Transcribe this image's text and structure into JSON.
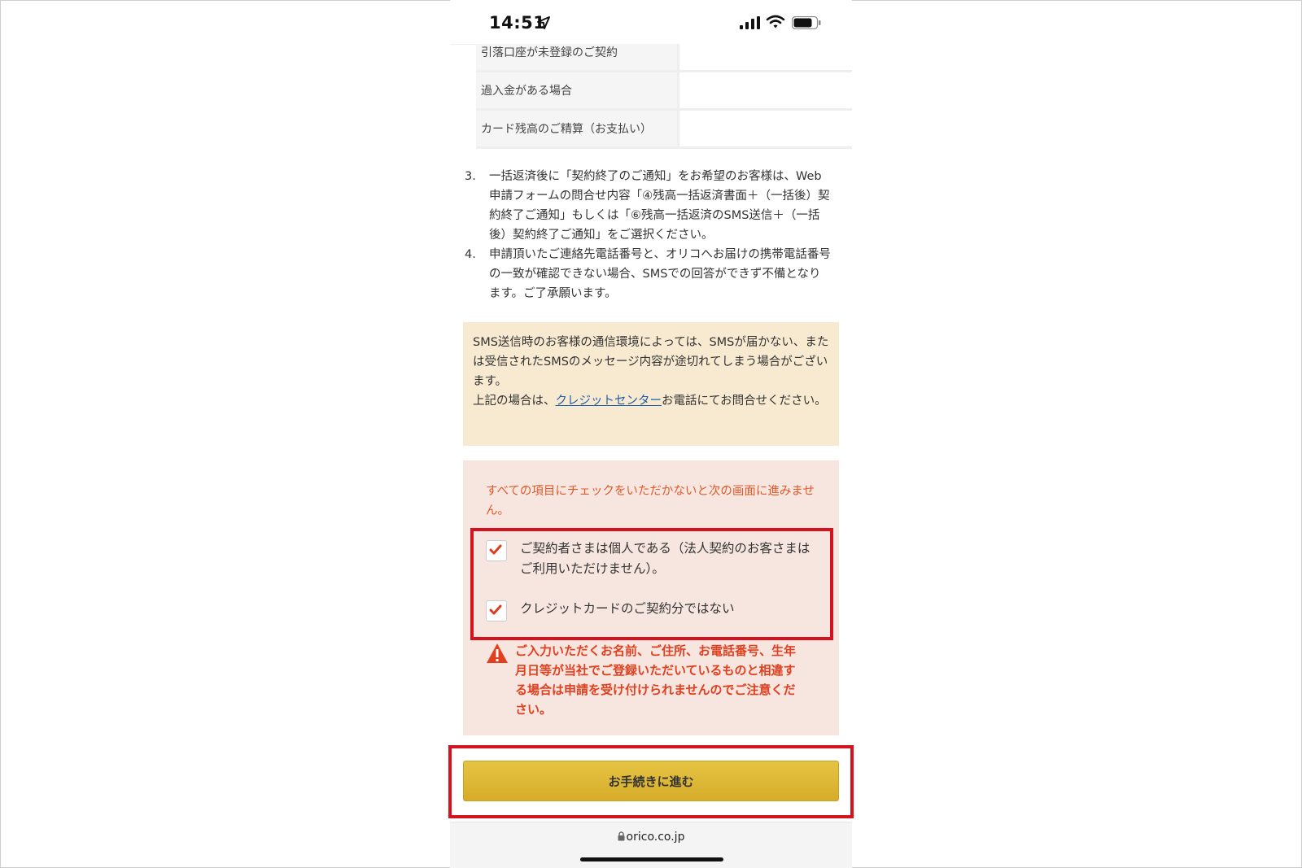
{
  "status_bar": {
    "time": "14:51"
  },
  "table": {
    "rows": [
      {
        "label": "引落口座が未登録のご契約"
      },
      {
        "label": "過入金がある場合"
      },
      {
        "label": "カード残高のご精算（お支払い）"
      }
    ]
  },
  "notes": [
    {
      "num": "3.",
      "text": "一括返済後に「契約終了のご通知」をお希望のお客様は、Web申請フォームの問合せ内容「④残高一括返済書面＋（一括後）契約終了ご通知」もしくは「⑥残高一括返済のSMS送信＋（一括後）契約終了ご通知」をご選択ください。"
    },
    {
      "num": "4.",
      "text": "申請頂いたご連絡先電話番号と、オリコへお届けの携帯電話番号の一致が確認できない場合、SMSでの回答ができず不備となります。ご了承願います。"
    }
  ],
  "sms_notice": {
    "line1": "SMS送信時のお客様の通信環境によっては、SMSが届かない、または受信されたSMSのメッセージ内容が途切れてしまう場合がございます。",
    "line2_before": "上記の場合は、",
    "link": "クレジットセンター",
    "line2_after": "お電話にてお問合せください。"
  },
  "check_section": {
    "warning": "すべての項目にチェックをいただかないと次の画面に進みません。",
    "items": [
      {
        "label": "ご契約者さまは個人である（法人契約のお客さまはご利用いただけません）。",
        "checked": true
      },
      {
        "label": "クレジットカードのご契約分ではない",
        "checked": true
      }
    ],
    "alert": "ご入力いただくお名前、ご住所、お電話番号、生年月日等が当社でご登録いただいているものと相違する場合は申請を受け付けられませんのでご注意ください。"
  },
  "proceed_button": {
    "label": "お手続きに進む"
  },
  "browser": {
    "url": "orico.co.jp"
  },
  "colors": {
    "accent_red": "#d6121e",
    "warning_orange": "#e05a2b",
    "button_gold": "#e0b935",
    "link_blue": "#1f5ea8"
  }
}
